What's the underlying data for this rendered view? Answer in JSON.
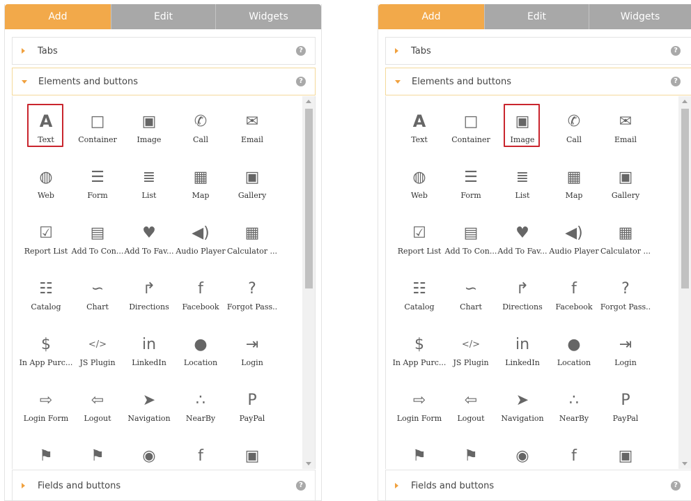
{
  "tabs": {
    "add": "Add",
    "edit": "Edit",
    "widgets": "Widgets"
  },
  "sections": {
    "tabs": "Tabs",
    "elements": "Elements and buttons",
    "fields": "Fields and buttons",
    "help": "?"
  },
  "colors": {
    "accent": "#f2a94a",
    "tab_inactive": "#a8a8a8",
    "highlight": "#c9252d"
  },
  "items": [
    {
      "label": "Text",
      "icon": "text-icon"
    },
    {
      "label": "Container",
      "icon": "container-icon"
    },
    {
      "label": "Image",
      "icon": "image-icon"
    },
    {
      "label": "Call",
      "icon": "phone-icon"
    },
    {
      "label": "Email",
      "icon": "envelope-icon"
    },
    {
      "label": "Web",
      "icon": "globe-icon"
    },
    {
      "label": "Form",
      "icon": "form-icon"
    },
    {
      "label": "List",
      "icon": "list-star-icon"
    },
    {
      "label": "Map",
      "icon": "map-icon"
    },
    {
      "label": "Gallery",
      "icon": "gallery-icon"
    },
    {
      "label": "Report List",
      "icon": "report-list-icon"
    },
    {
      "label": "Add To Con...",
      "icon": "add-contact-icon"
    },
    {
      "label": "Add To Fav...",
      "icon": "heart-plus-icon"
    },
    {
      "label": "Audio Player",
      "icon": "speaker-icon"
    },
    {
      "label": "Calculator ...",
      "icon": "calculator-icon"
    },
    {
      "label": "Catalog",
      "icon": "catalog-icon"
    },
    {
      "label": "Chart",
      "icon": "chart-icon"
    },
    {
      "label": "Directions",
      "icon": "directions-arrow-icon"
    },
    {
      "label": "Facebook",
      "icon": "facebook-icon"
    },
    {
      "label": "Forgot Pass..",
      "icon": "question-mark-icon"
    },
    {
      "label": "In App Purc...",
      "icon": "dollar-icon"
    },
    {
      "label": "JS Plugin",
      "icon": "code-icon"
    },
    {
      "label": "LinkedIn",
      "icon": "linkedin-icon"
    },
    {
      "label": "Location",
      "icon": "location-pin-icon"
    },
    {
      "label": "Login",
      "icon": "login-icon"
    },
    {
      "label": "Login Form",
      "icon": "login-form-icon"
    },
    {
      "label": "Logout",
      "icon": "logout-icon"
    },
    {
      "label": "Navigation",
      "icon": "navigation-icon"
    },
    {
      "label": "NearBy",
      "icon": "nearby-icon"
    },
    {
      "label": "PayPal",
      "icon": "paypal-icon"
    },
    {
      "label": "",
      "icon": "flag-icon"
    },
    {
      "label": "",
      "icon": "flag-icon"
    },
    {
      "label": "",
      "icon": "camera-icon"
    },
    {
      "label": "",
      "icon": "facebook-square-icon"
    },
    {
      "label": "",
      "icon": "twitter-square-icon"
    }
  ],
  "glyphs": [
    "A",
    "□",
    "▣",
    "✆",
    "✉",
    "◍",
    "☰",
    "≣",
    "▦",
    "▣",
    "☑",
    "▤",
    "♥",
    "◀)",
    "▦",
    "☷",
    "∽",
    "↱",
    "f",
    "?",
    "$",
    "</>",
    "in",
    "●",
    "⇥",
    "⇨",
    "⇦",
    "➤",
    "∴",
    "P",
    "⚑",
    "⚑",
    "◉",
    "f",
    "▣"
  ],
  "highlight": {
    "left": "Text",
    "right": "Image"
  }
}
